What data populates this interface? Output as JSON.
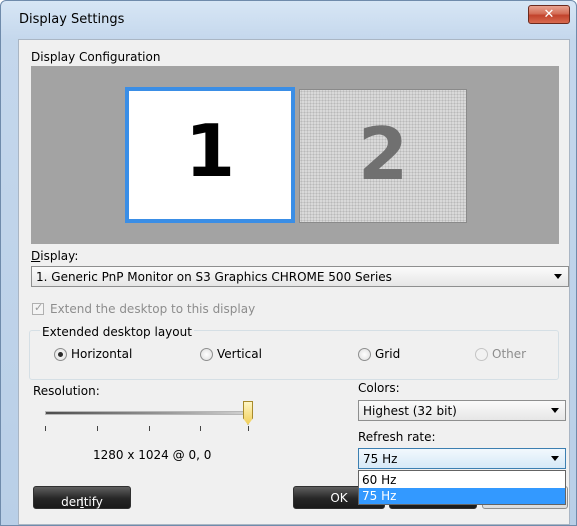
{
  "window": {
    "title": "Display Settings",
    "close_symbol": "✕"
  },
  "config": {
    "label": "Display Configuration",
    "monitors": [
      {
        "number": "1"
      },
      {
        "number": "2"
      }
    ]
  },
  "display": {
    "label": "Display:",
    "selected": "1. Generic PnP Monitor on S3 Graphics CHROME 500 Series"
  },
  "extend": {
    "label": "Extend the desktop to this display",
    "checked": true
  },
  "layout": {
    "label": "Extended desktop layout",
    "options": [
      "Horizontal",
      "Vertical",
      "Grid",
      "Other"
    ],
    "selected": "Horizontal"
  },
  "resolution": {
    "label": "Resolution:",
    "text": "1280 x 1024 @ 0, 0",
    "slider_level": 1.0
  },
  "colors": {
    "label": "Colors:",
    "selected": "Highest (32 bit)"
  },
  "refresh": {
    "label": "Refresh rate:",
    "selected": "75 Hz",
    "options": [
      "60 Hz",
      "75 Hz"
    ]
  },
  "buttons": {
    "identify": "Identify",
    "ok": "OK"
  },
  "style": {
    "accent": "#3a8ee6",
    "highlight": "#3399ff"
  }
}
